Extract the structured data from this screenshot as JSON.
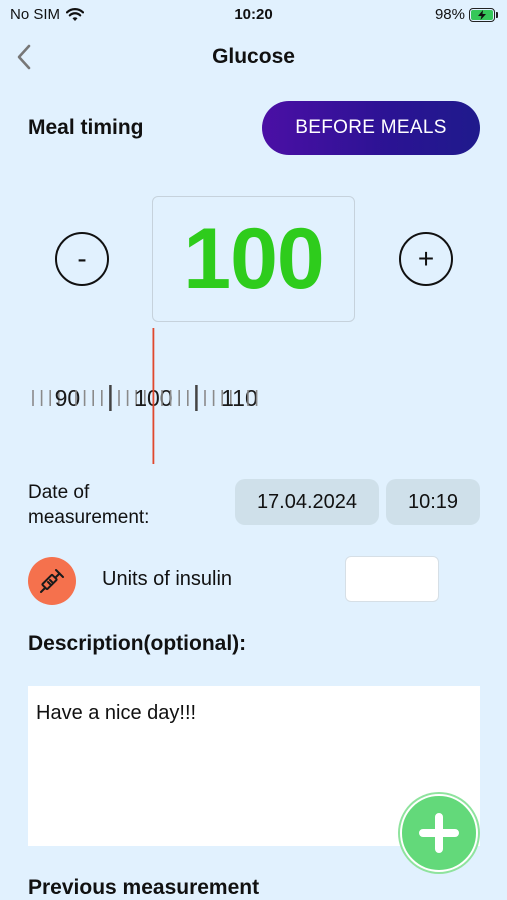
{
  "status_bar": {
    "carrier": "No SIM",
    "time": "10:20",
    "battery": "98%"
  },
  "nav": {
    "title": "Glucose"
  },
  "meal": {
    "label": "Meal timing",
    "button": "BEFORE MEALS"
  },
  "stepper": {
    "minus": "-",
    "plus": "+",
    "value": "100"
  },
  "ruler": {
    "labels": [
      "90",
      "100",
      "110"
    ],
    "min": 86,
    "max": 112,
    "selected": 100,
    "indicator_color": "#e0482d"
  },
  "date": {
    "label": "Date of measurement:",
    "date": "17.04.2024",
    "time": "10:19"
  },
  "insulin": {
    "label": "Units of insulin",
    "value": "",
    "icon": "syringe-icon"
  },
  "description": {
    "label": "Description(optional):",
    "value": "Have a nice day!!!"
  },
  "previous": {
    "label": "Previous measurement"
  },
  "colors": {
    "background": "#e1f1fe",
    "value_green": "#2ecc1c",
    "button_purple": "#3c11a0",
    "insulin_orange": "#f5714d",
    "fab_green": "#63d97a"
  }
}
